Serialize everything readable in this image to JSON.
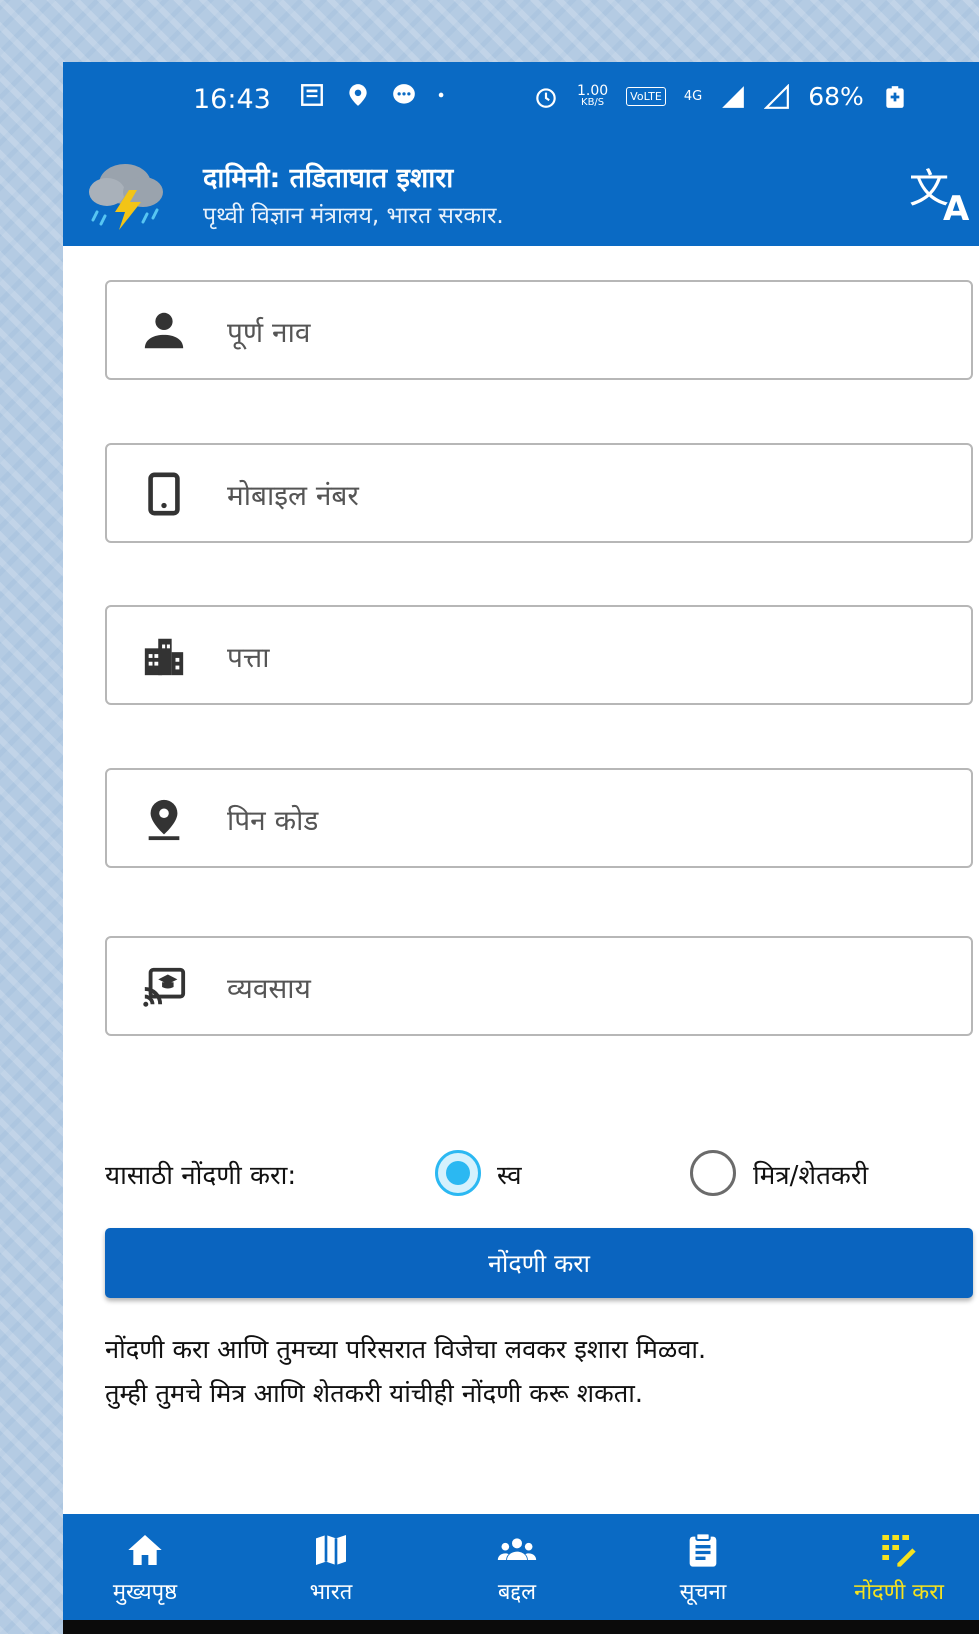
{
  "status_bar": {
    "time": "16:43",
    "network_speed": "1.00",
    "network_unit": "KB/S",
    "volte": "VoLTE",
    "network_type": "4G",
    "battery": "68%"
  },
  "app_bar": {
    "title": "दामिनी: तडिताघात इशारा",
    "subtitle": "पृथ्वी विज्ञान मंत्रालय, भारत सरकार.",
    "logo_icon": "storm-cloud-lightning-icon",
    "translate_icon": "translate-icon"
  },
  "form": {
    "fields": [
      {
        "icon": "person-icon",
        "placeholder": "पूर्ण नाव",
        "value": ""
      },
      {
        "icon": "mobile-phone-icon",
        "placeholder": "मोबाइल नंबर",
        "value": ""
      },
      {
        "icon": "building-icon",
        "placeholder": "पत्ता",
        "value": ""
      },
      {
        "icon": "location-pin-icon",
        "placeholder": "पिन कोड",
        "value": ""
      },
      {
        "icon": "occupation-icon",
        "placeholder": "व्यवसाय",
        "value": ""
      }
    ],
    "register_for_label": "यासाठी नोंदणी करा:",
    "options": [
      {
        "label": "स्व",
        "selected": true
      },
      {
        "label": "मित्र/शेतकरी",
        "selected": false
      }
    ],
    "submit_label": "नोंदणी करा"
  },
  "info_lines": [
    "नोंदणी करा आणि तुमच्या परिसरात विजेचा लवकर इशारा मिळवा.",
    "तुम्ही तुमचे मित्र आणि शेतकरी यांचीही नोंदणी करू शकता."
  ],
  "bottom_nav": [
    {
      "label": "मुख्यपृष्ठ",
      "icon": "home-icon",
      "active": false
    },
    {
      "label": "भारत",
      "icon": "map-icon",
      "active": false
    },
    {
      "label": "बद्दल",
      "icon": "group-icon",
      "active": false
    },
    {
      "label": "सूचना",
      "icon": "clipboard-icon",
      "active": false
    },
    {
      "label": "नोंदणी करा",
      "icon": "register-icon",
      "active": true
    }
  ],
  "colors": {
    "primary": "#0a6ac4",
    "active_nav": "#f5e21f",
    "radio_selected": "#2bb8f2"
  }
}
